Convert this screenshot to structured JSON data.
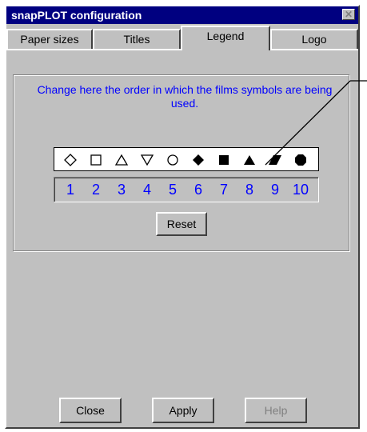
{
  "window": {
    "title": "snapPLOT configuration",
    "close_glyph": "✕"
  },
  "tabs": [
    {
      "label": "Paper sizes",
      "active": false
    },
    {
      "label": "Titles",
      "active": false
    },
    {
      "label": "Legend",
      "active": true
    },
    {
      "label": "Logo",
      "active": false
    }
  ],
  "legend": {
    "instruction": "Change here the order in which the films symbols are being used.",
    "symbols": [
      {
        "icon": "open-diamond-icon"
      },
      {
        "icon": "open-square-icon"
      },
      {
        "icon": "open-triangle-up-icon"
      },
      {
        "icon": "open-triangle-down-icon"
      },
      {
        "icon": "open-circle-icon"
      },
      {
        "icon": "filled-diamond-icon"
      },
      {
        "icon": "filled-square-icon"
      },
      {
        "icon": "filled-triangle-icon"
      },
      {
        "icon": "filled-parallelogram-icon"
      },
      {
        "icon": "filled-octagon-icon"
      }
    ],
    "numbers": [
      "1",
      "2",
      "3",
      "4",
      "5",
      "6",
      "7",
      "8",
      "9",
      "10"
    ],
    "reset_label": "Reset",
    "number_color": "#0000ff"
  },
  "footer": {
    "close_label": "Close",
    "apply_label": "Apply",
    "help_label": "Help"
  },
  "colors": {
    "titlebar": "#000080",
    "face": "#c0c0c0",
    "accent_text": "#0000ff"
  }
}
